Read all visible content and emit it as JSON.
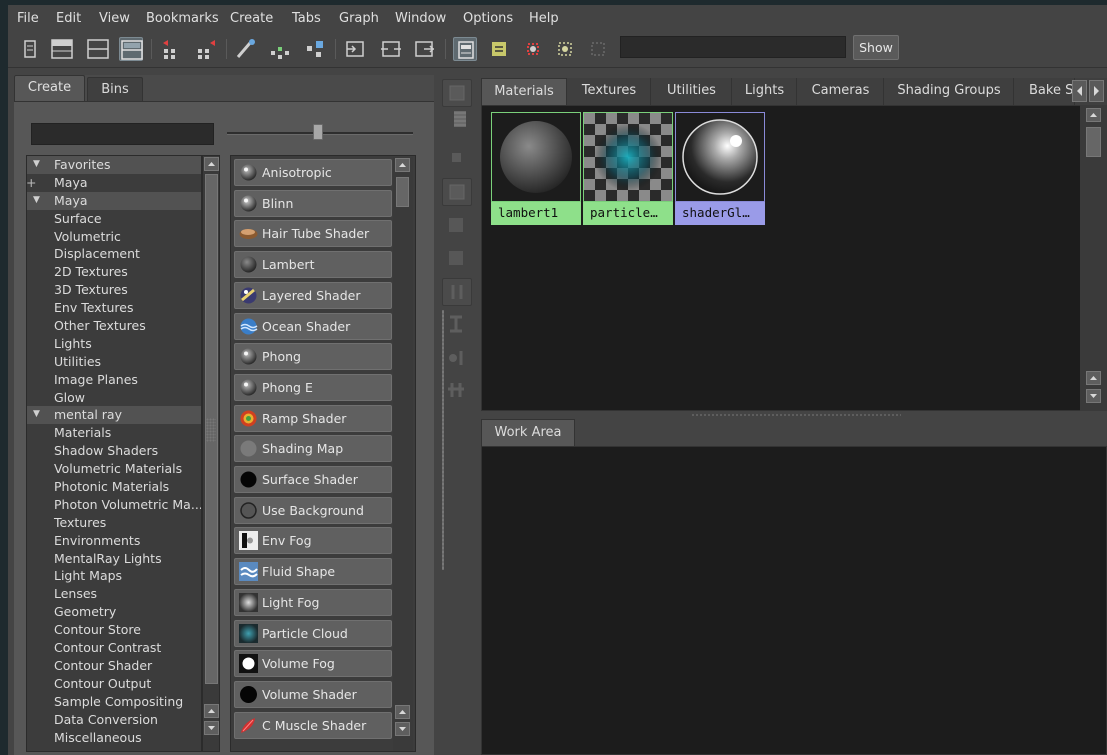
{
  "menubar": {
    "items": [
      "File",
      "Edit",
      "View",
      "Bookmarks",
      "Create",
      "Tabs",
      "Graph",
      "Window",
      "Options",
      "Help"
    ]
  },
  "toolbar": {
    "search_value": "",
    "show_label": "Show",
    "icons": [
      "toggle-panel-icon",
      "show-top-tabs-icon",
      "show-bottom-tabs-icon",
      "show-both-tabs-icon",
      "input-output-connections-icon",
      "output-connections-icon",
      "graph-materials-icon",
      "remove-unused-icon",
      "rearrange-graph-icon",
      "input-connections-icon",
      "input-output-icon",
      "output-icon",
      "swatches-icon",
      "names-icon",
      "filter-icon",
      "tree-icon",
      "sort-icon"
    ]
  },
  "left_panel": {
    "tabs": [
      "Create",
      "Bins"
    ],
    "filter_value": "",
    "tree": [
      {
        "label": "Favorites",
        "type": "header"
      },
      {
        "label": "Maya",
        "type": "plus"
      },
      {
        "label": "Maya",
        "type": "header"
      },
      {
        "label": "Surface",
        "type": "child"
      },
      {
        "label": "Volumetric",
        "type": "child"
      },
      {
        "label": "Displacement",
        "type": "child"
      },
      {
        "label": "2D Textures",
        "type": "child"
      },
      {
        "label": "3D Textures",
        "type": "child"
      },
      {
        "label": "Env Textures",
        "type": "child"
      },
      {
        "label": "Other Textures",
        "type": "child"
      },
      {
        "label": "Lights",
        "type": "child"
      },
      {
        "label": "Utilities",
        "type": "child"
      },
      {
        "label": "Image Planes",
        "type": "child"
      },
      {
        "label": "Glow",
        "type": "child"
      },
      {
        "label": "mental ray",
        "type": "header"
      },
      {
        "label": "Materials",
        "type": "child"
      },
      {
        "label": "Shadow Shaders",
        "type": "child"
      },
      {
        "label": "Volumetric Materials",
        "type": "child"
      },
      {
        "label": "Photonic Materials",
        "type": "child"
      },
      {
        "label": "Photon Volumetric Ma...",
        "type": "child"
      },
      {
        "label": "Textures",
        "type": "child"
      },
      {
        "label": "Environments",
        "type": "child"
      },
      {
        "label": "MentalRay Lights",
        "type": "child"
      },
      {
        "label": "Light Maps",
        "type": "child"
      },
      {
        "label": "Lenses",
        "type": "child"
      },
      {
        "label": "Geometry",
        "type": "child"
      },
      {
        "label": "Contour Store",
        "type": "child"
      },
      {
        "label": "Contour Contrast",
        "type": "child"
      },
      {
        "label": "Contour Shader",
        "type": "child"
      },
      {
        "label": "Contour Output",
        "type": "child"
      },
      {
        "label": "Sample Compositing",
        "type": "child"
      },
      {
        "label": "Data Conversion",
        "type": "child"
      },
      {
        "label": "Miscellaneous",
        "type": "child"
      }
    ],
    "shaders": [
      {
        "label": "Anisotropic",
        "icon": "anisotropic-sphere-icon"
      },
      {
        "label": "Blinn",
        "icon": "blinn-sphere-icon"
      },
      {
        "label": "Hair Tube Shader",
        "icon": "hair-tube-icon"
      },
      {
        "label": "Lambert",
        "icon": "lambert-sphere-icon"
      },
      {
        "label": "Layered Shader",
        "icon": "layered-shader-icon"
      },
      {
        "label": "Ocean Shader",
        "icon": "ocean-shader-icon"
      },
      {
        "label": "Phong",
        "icon": "phong-sphere-icon"
      },
      {
        "label": "Phong E",
        "icon": "phonge-sphere-icon"
      },
      {
        "label": "Ramp Shader",
        "icon": "ramp-shader-icon"
      },
      {
        "label": "Shading Map",
        "icon": "shading-map-icon"
      },
      {
        "label": "Surface Shader",
        "icon": "surface-shader-icon"
      },
      {
        "label": "Use Background",
        "icon": "use-background-icon"
      },
      {
        "label": "Env Fog",
        "icon": "env-fog-icon"
      },
      {
        "label": "Fluid Shape",
        "icon": "fluid-shape-icon"
      },
      {
        "label": "Light Fog",
        "icon": "light-fog-icon"
      },
      {
        "label": "Particle Cloud",
        "icon": "particle-cloud-icon"
      },
      {
        "label": "Volume Fog",
        "icon": "volume-fog-icon"
      },
      {
        "label": "Volume Shader",
        "icon": "volume-shader-icon"
      },
      {
        "label": "C Muscle Shader",
        "icon": "muscle-shader-icon"
      }
    ]
  },
  "top_tabs": [
    "Materials",
    "Textures",
    "Utilities",
    "Lights",
    "Cameras",
    "Shading Groups",
    "Bake S"
  ],
  "materials": [
    {
      "name": "lambert1",
      "style": "green",
      "icon": "lambert-sphere-icon"
    },
    {
      "name": "particle…",
      "style": "green",
      "icon": "particle-cloud-icon"
    },
    {
      "name": "shaderGl…",
      "style": "blue",
      "icon": "shader-glow-icon"
    }
  ],
  "work_area": {
    "tab": "Work Area"
  },
  "colors": {
    "background": "#444444",
    "panel_dark": "#1c1c1c",
    "swatch_green": "#8ee08a",
    "swatch_blue": "#9a9be8"
  }
}
